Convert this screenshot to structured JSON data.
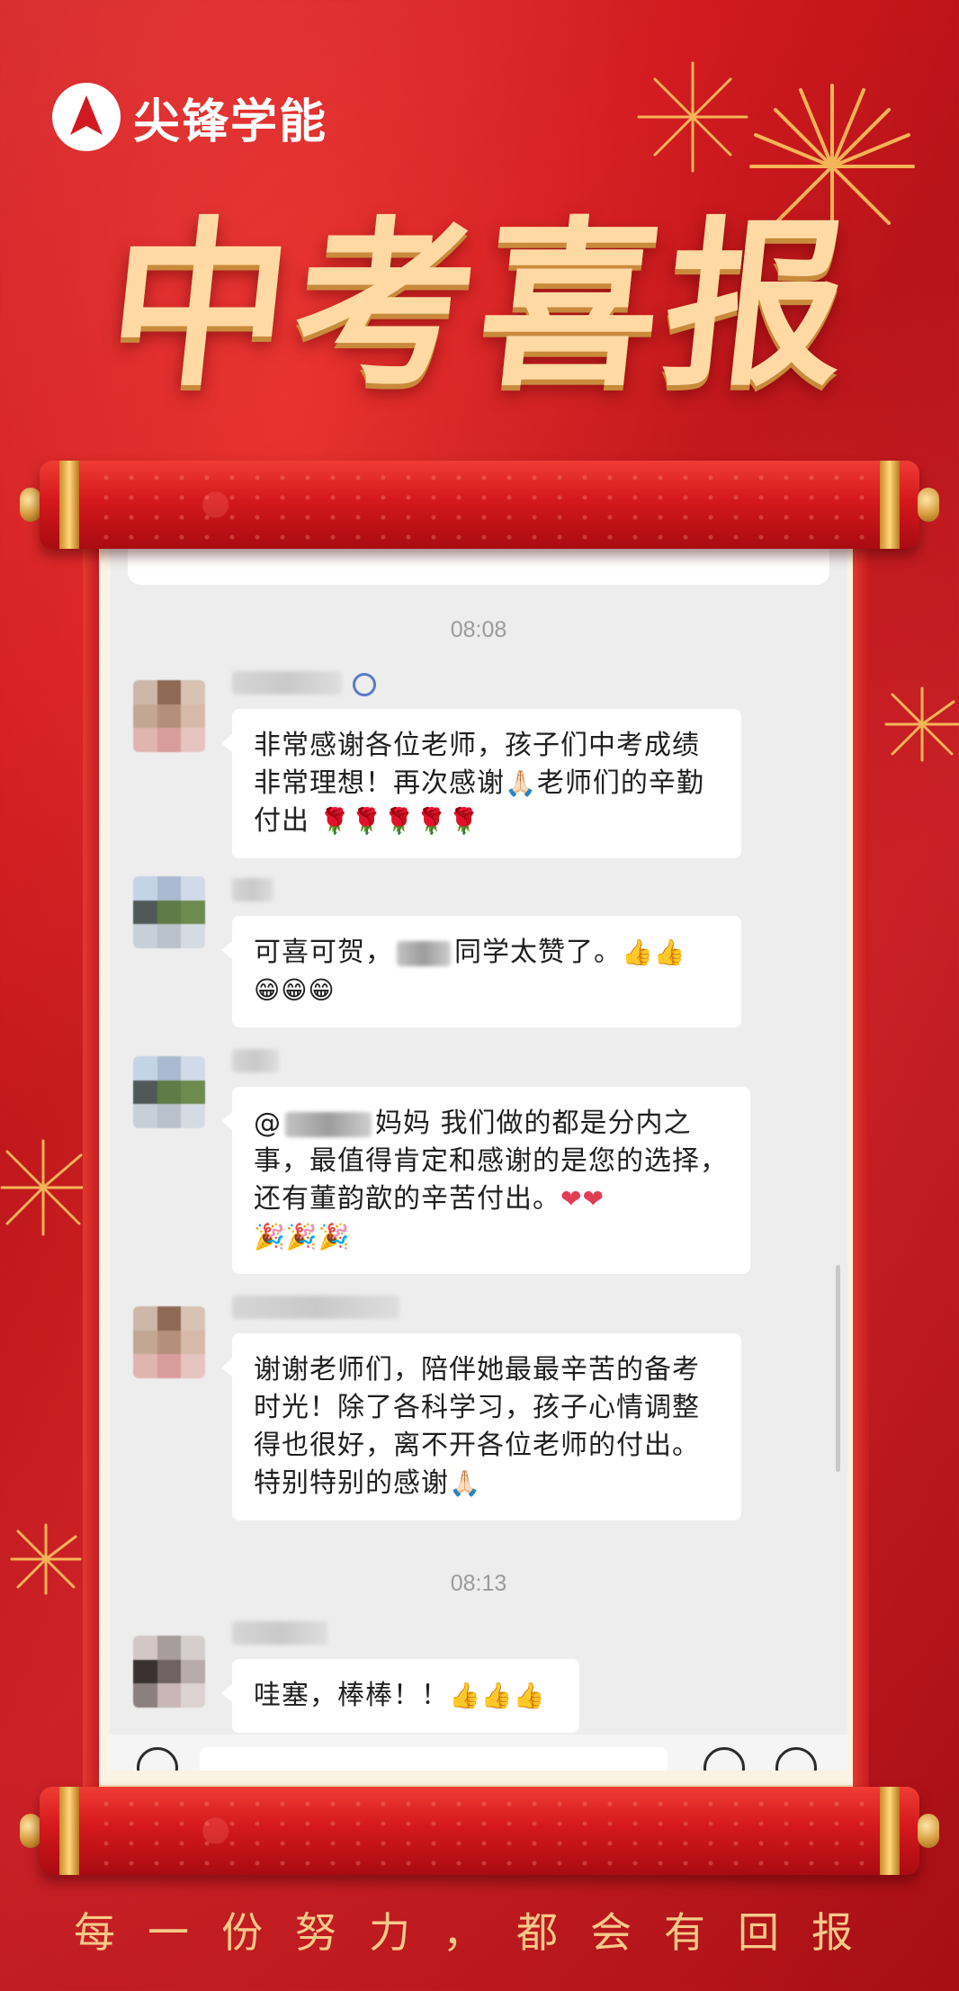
{
  "brand": {
    "name": "尖锋学能",
    "logo_icon": "arrow-up-logo"
  },
  "headline": "中考喜报",
  "chat": {
    "time_1": "08:08",
    "time_2": "08:13",
    "messages": [
      {
        "id": "m1",
        "text_a": "非常感谢各位老师，孩子们中考成绩非常理想！再次感谢",
        "emoji_a": "🙏🏻",
        "text_b": "老师们的辛勤付出",
        "emoji_b": "🌹🌹🌹🌹🌹"
      },
      {
        "id": "m2",
        "text_a": "可喜可贺，",
        "text_b": "同学太赞了。",
        "emoji_a": "👍👍",
        "emoji_b": "😁😁😁"
      },
      {
        "id": "m3",
        "text_a": "@",
        "text_b": "妈妈 我们做的都是分内之事，最值得肯定和感谢的是您的选择，还有董韵歆的辛苦付出。",
        "emoji_a": "❤❤",
        "emoji_b": "🎉🎉🎉"
      },
      {
        "id": "m4",
        "text_a": "谢谢老师们，陪伴她最最辛苦的备考时光！除了各科学习，孩子心情调整得也很好，离不开各位老师的付出。特别特别的感谢",
        "emoji_a": "🙏🏻"
      },
      {
        "id": "m5",
        "text_a": "哇塞，棒棒！！",
        "emoji_a": "👍👍👍"
      }
    ]
  },
  "slogan": "每一份努力，都会有回报",
  "colors": {
    "background": "#d11a1f",
    "headline": "#ffd9a4",
    "slogan": "#f7c98a",
    "chat_bg": "#ededed"
  }
}
